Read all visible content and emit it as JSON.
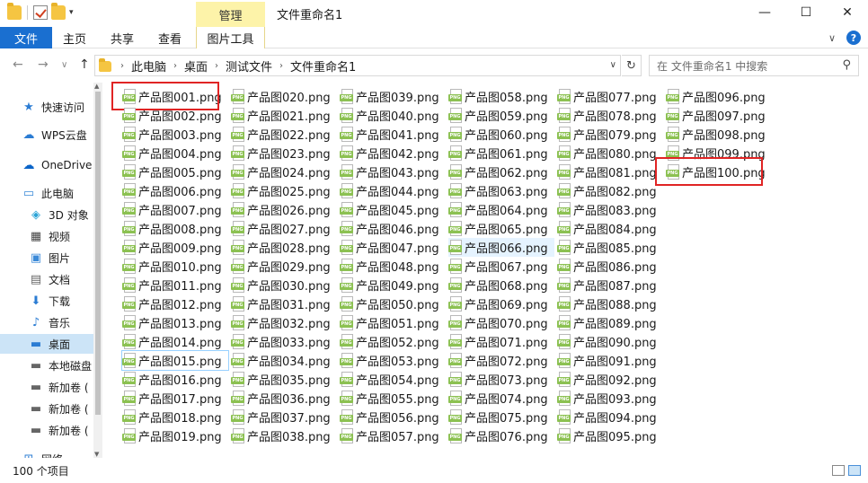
{
  "window": {
    "title": "文件重命名1",
    "context_tab": "管理",
    "controls": {
      "minimize": "—",
      "maximize": "☐",
      "close": "✕"
    }
  },
  "ribbon": {
    "tabs": [
      {
        "label": "文件"
      },
      {
        "label": "主页"
      },
      {
        "label": "共享"
      },
      {
        "label": "查看"
      },
      {
        "label": "图片工具"
      }
    ],
    "expand": "∨",
    "help": "?"
  },
  "nav": {
    "back": "←",
    "forward": "→",
    "recent": "∨",
    "up": "↑",
    "breadcrumb": [
      "此电脑",
      "桌面",
      "测试文件",
      "文件重命名1"
    ],
    "search_placeholder": "在 文件重命名1 中搜索"
  },
  "sidebar": {
    "items": [
      {
        "label": "快速访问",
        "icon": "star-icon",
        "glyph": "★",
        "color": "#2b7cd3"
      },
      {
        "label": "WPS云盘",
        "icon": "cloud-icon",
        "glyph": "☁",
        "color": "#2b7cd3"
      },
      {
        "label": "OneDrive",
        "icon": "onedrive-icon",
        "glyph": "☁",
        "color": "#0a64c8"
      },
      {
        "label": "此电脑",
        "icon": "computer-icon",
        "glyph": "▭",
        "color": "#3b8ad8"
      },
      {
        "label": "3D 对象",
        "icon": "cube-icon",
        "glyph": "◈",
        "color": "#29a3d6"
      },
      {
        "label": "视频",
        "icon": "video-icon",
        "glyph": "▦",
        "color": "#444444"
      },
      {
        "label": "图片",
        "icon": "picture-icon",
        "glyph": "▣",
        "color": "#3b8ad8"
      },
      {
        "label": "文档",
        "icon": "document-icon",
        "glyph": "▤",
        "color": "#666666"
      },
      {
        "label": "下载",
        "icon": "download-icon",
        "glyph": "⬇",
        "color": "#2b7cd3"
      },
      {
        "label": "音乐",
        "icon": "music-icon",
        "glyph": "♪",
        "color": "#2b7cd3"
      },
      {
        "label": "桌面",
        "icon": "desktop-icon",
        "glyph": "▬",
        "color": "#2b7cd3",
        "selected": true
      },
      {
        "label": "本地磁盘",
        "icon": "drive-icon",
        "glyph": "▬",
        "color": "#666666"
      },
      {
        "label": "新加卷 (",
        "icon": "drive-icon",
        "glyph": "▬",
        "color": "#666666"
      },
      {
        "label": "新加卷 (",
        "icon": "drive-icon",
        "glyph": "▬",
        "color": "#666666"
      },
      {
        "label": "新加卷 (",
        "icon": "drive-icon",
        "glyph": "▬",
        "color": "#666666"
      },
      {
        "label": "网络",
        "icon": "network-icon",
        "glyph": "⊞",
        "color": "#2b7cd3"
      }
    ]
  },
  "files": {
    "prefix": "产品图",
    "extension": ".png",
    "count": 100,
    "rows_per_column": 19,
    "hover_index": 66,
    "focus_index": 15,
    "highlighted": [
      1,
      100
    ],
    "icon_label": "PNG"
  },
  "status": {
    "item_count": "100 个项目"
  },
  "colors": {
    "accent": "#1a6fd0",
    "manage_tab": "#fdf3a9",
    "highlight_box": "#e02424",
    "selection": "#cce4f7"
  }
}
